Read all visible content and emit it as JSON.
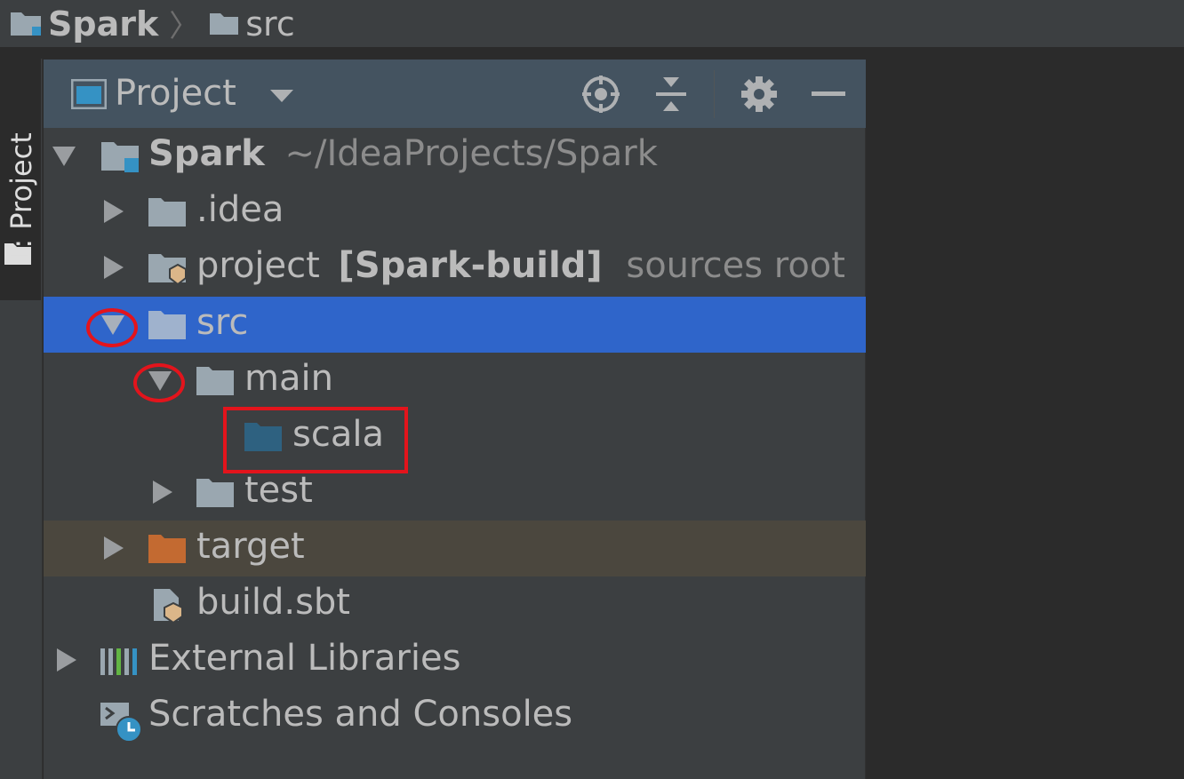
{
  "breadcrumb": {
    "items": [
      {
        "label": "Spark",
        "bold": true,
        "icon": "project-folder-icon"
      },
      {
        "label": "src",
        "bold": false,
        "icon": "folder-icon"
      }
    ]
  },
  "tool_stripe": {
    "tab_label": "1: Project"
  },
  "panel": {
    "title": "Project",
    "toolbar": [
      "locate-icon",
      "collapse-all-icon",
      "gear-icon",
      "hide-icon"
    ]
  },
  "tree": {
    "root": {
      "name": "Spark",
      "path": "~/IdeaProjects/Spark"
    },
    "idea": {
      "name": ".idea"
    },
    "project": {
      "name": "project",
      "module": "[Spark-build]",
      "note": "sources root"
    },
    "src": {
      "name": "src"
    },
    "main": {
      "name": "main"
    },
    "scala": {
      "name": "scala"
    },
    "test": {
      "name": "test"
    },
    "target": {
      "name": "target"
    },
    "build_sbt": {
      "name": "build.sbt"
    },
    "external_libraries": {
      "name": "External Libraries"
    },
    "scratches": {
      "name": "Scratches and Consoles"
    }
  },
  "colors": {
    "selection": "#2f65ca",
    "excluded_row": "#4b473e",
    "source_folder": "#2e6180",
    "excluded_folder": "#c36a31",
    "annotation": "#e3141c"
  }
}
